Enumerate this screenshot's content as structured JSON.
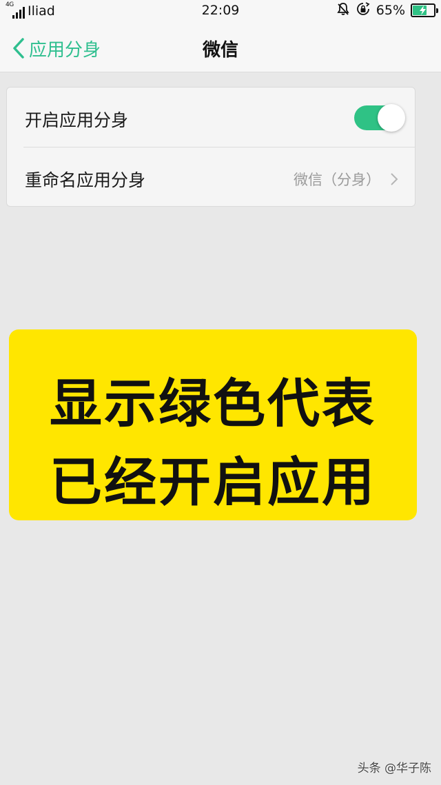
{
  "status_bar": {
    "network": "4G",
    "carrier": "Iliad",
    "time": "22:09",
    "battery": "65%",
    "battery_level": 0.65,
    "icons": [
      "signal-icon",
      "mute-bell-icon",
      "rotation-lock-icon",
      "battery-icon"
    ]
  },
  "nav": {
    "back_label": "应用分身",
    "title": "微信"
  },
  "settings": {
    "rows": [
      {
        "label": "开启应用分身",
        "toggle_on": true
      },
      {
        "label": "重命名应用分身",
        "value": "微信（分身）"
      }
    ]
  },
  "overlay": {
    "line1": "显示绿色代表",
    "line2": "已经开启应用"
  },
  "watermark": "头条 @华子陈",
  "colors": {
    "accent": "#2fc285",
    "highlight": "#ffe600",
    "background": "#e8e8e8"
  }
}
